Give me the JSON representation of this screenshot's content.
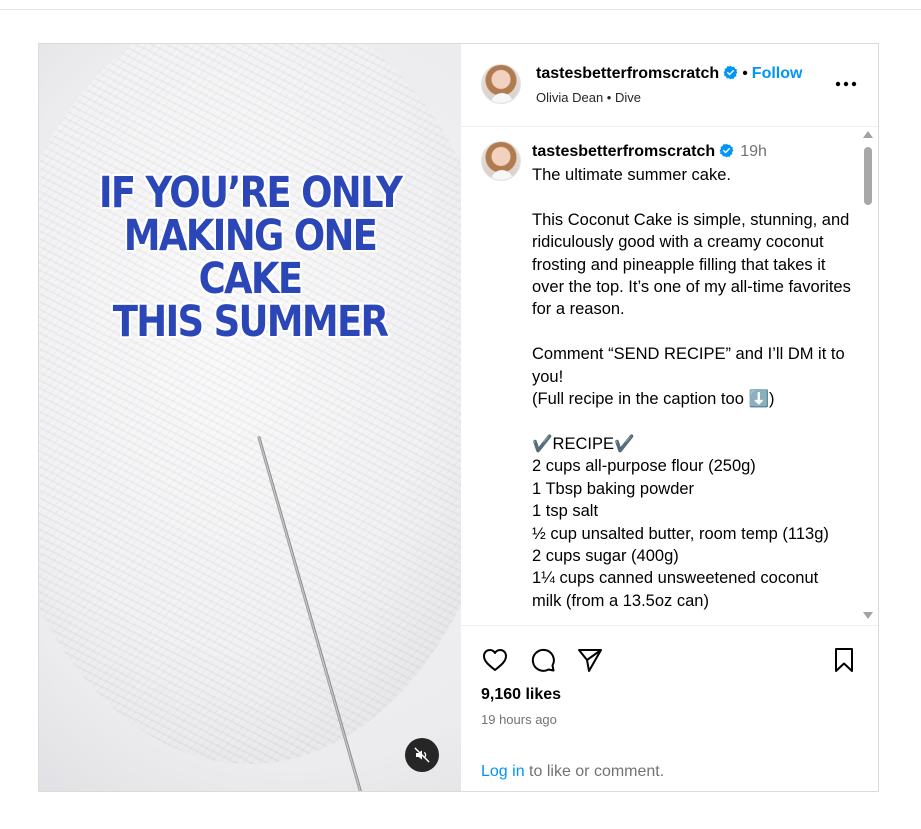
{
  "post": {
    "media": {
      "overlay_lines": [
        "IF YOU’RE ONLY",
        "MAKING ONE CAKE",
        "THIS SUMMER"
      ]
    },
    "header": {
      "username": "tastesbetterfromscratch",
      "dot": "•",
      "follow_label": "Follow",
      "audio": "Olivia Dean • Dive"
    },
    "caption": {
      "username": "tastesbetterfromscratch",
      "time": "19h",
      "text": "The ultimate summer cake.\n\nThis Coconut Cake is simple, stunning, and ridiculously good with a creamy coconut frosting and pineapple filling that takes it over the top. It’s one of my all-time favorites for a reason.\n\nComment “SEND RECIPE” and I’ll DM it to you!\n(Full recipe in the caption too ⬇️)\n\n✔️RECIPE✔️\n2 cups all-purpose flour (250g)\n1 Tbsp baking powder\n1 tsp salt\n½ cup unsalted butter, room temp (113g)\n2 cups sugar (400g)\n1¼ cups canned unsweetened coconut milk (from a 13.5oz can)"
    },
    "actions": {
      "likes": "9,160 likes",
      "time_ago": "19 hours ago",
      "login_link": "Log in",
      "login_suffix": " to like or comment."
    }
  },
  "colors": {
    "accent": "#0095f6",
    "overlay_text": "#2b46b6",
    "muted": "#737373"
  },
  "icons": [
    "verified-badge-icon",
    "more-options-icon",
    "heart-icon",
    "comment-icon",
    "share-icon",
    "bookmark-icon",
    "mute-icon"
  ]
}
